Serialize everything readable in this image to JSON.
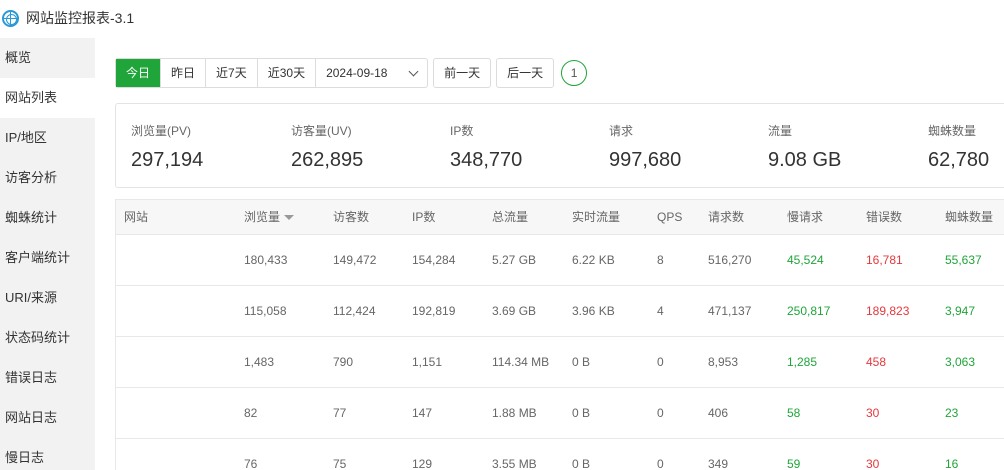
{
  "window": {
    "title": "网站监控报表-3.1"
  },
  "sidebar": {
    "items": [
      {
        "label": "概览"
      },
      {
        "label": "网站列表"
      },
      {
        "label": "IP/地区"
      },
      {
        "label": "访客分析"
      },
      {
        "label": "蜘蛛统计"
      },
      {
        "label": "客户端统计"
      },
      {
        "label": "URI/来源"
      },
      {
        "label": "状态码统计"
      },
      {
        "label": "错误日志"
      },
      {
        "label": "网站日志"
      },
      {
        "label": "慢日志"
      }
    ],
    "active_index": 1
  },
  "toolbar": {
    "range_buttons": [
      "今日",
      "昨日",
      "近7天",
      "近30天"
    ],
    "active_range": "今日",
    "date_value": "2024-09-18",
    "prev_label": "前一天",
    "next_label": "后一天",
    "refresh_count": "1"
  },
  "summary": {
    "pv_label": "浏览量(PV)",
    "pv_value": "297,194",
    "uv_label": "访客量(UV)",
    "uv_value": "262,895",
    "ip_label": "IP数",
    "ip_value": "348,770",
    "req_label": "请求",
    "req_value": "997,680",
    "flow_label": "流量",
    "flow_value": "9.08 GB",
    "spider_label": "蜘蛛数量",
    "spider_value": "62,780"
  },
  "table": {
    "headers": [
      "网站",
      "浏览量",
      "访客数",
      "IP数",
      "总流量",
      "实时流量",
      "QPS",
      "请求数",
      "慢请求",
      "错误数",
      "蜘蛛数量"
    ],
    "rows": [
      [
        "",
        "180,433",
        "149,472",
        "154,284",
        "5.27 GB",
        "6.22 KB",
        "8",
        "516,270",
        "45,524",
        "16,781",
        "55,637"
      ],
      [
        "",
        "115,058",
        "112,424",
        "192,819",
        "3.69 GB",
        "3.96 KB",
        "4",
        "471,137",
        "250,817",
        "189,823",
        "3,947"
      ],
      [
        "",
        "1,483",
        "790",
        "1,151",
        "114.34 MB",
        "0 B",
        "0",
        "8,953",
        "1,285",
        "458",
        "3,063"
      ],
      [
        "",
        "82",
        "77",
        "147",
        "1.88 MB",
        "0 B",
        "0",
        "406",
        "58",
        "30",
        "23"
      ],
      [
        "",
        "76",
        "75",
        "129",
        "3.55 MB",
        "0 B",
        "0",
        "349",
        "59",
        "30",
        "16"
      ]
    ]
  },
  "colors": {
    "accent": "#20a53a",
    "error": "#e4393c",
    "icon": "#2a9ad6"
  }
}
